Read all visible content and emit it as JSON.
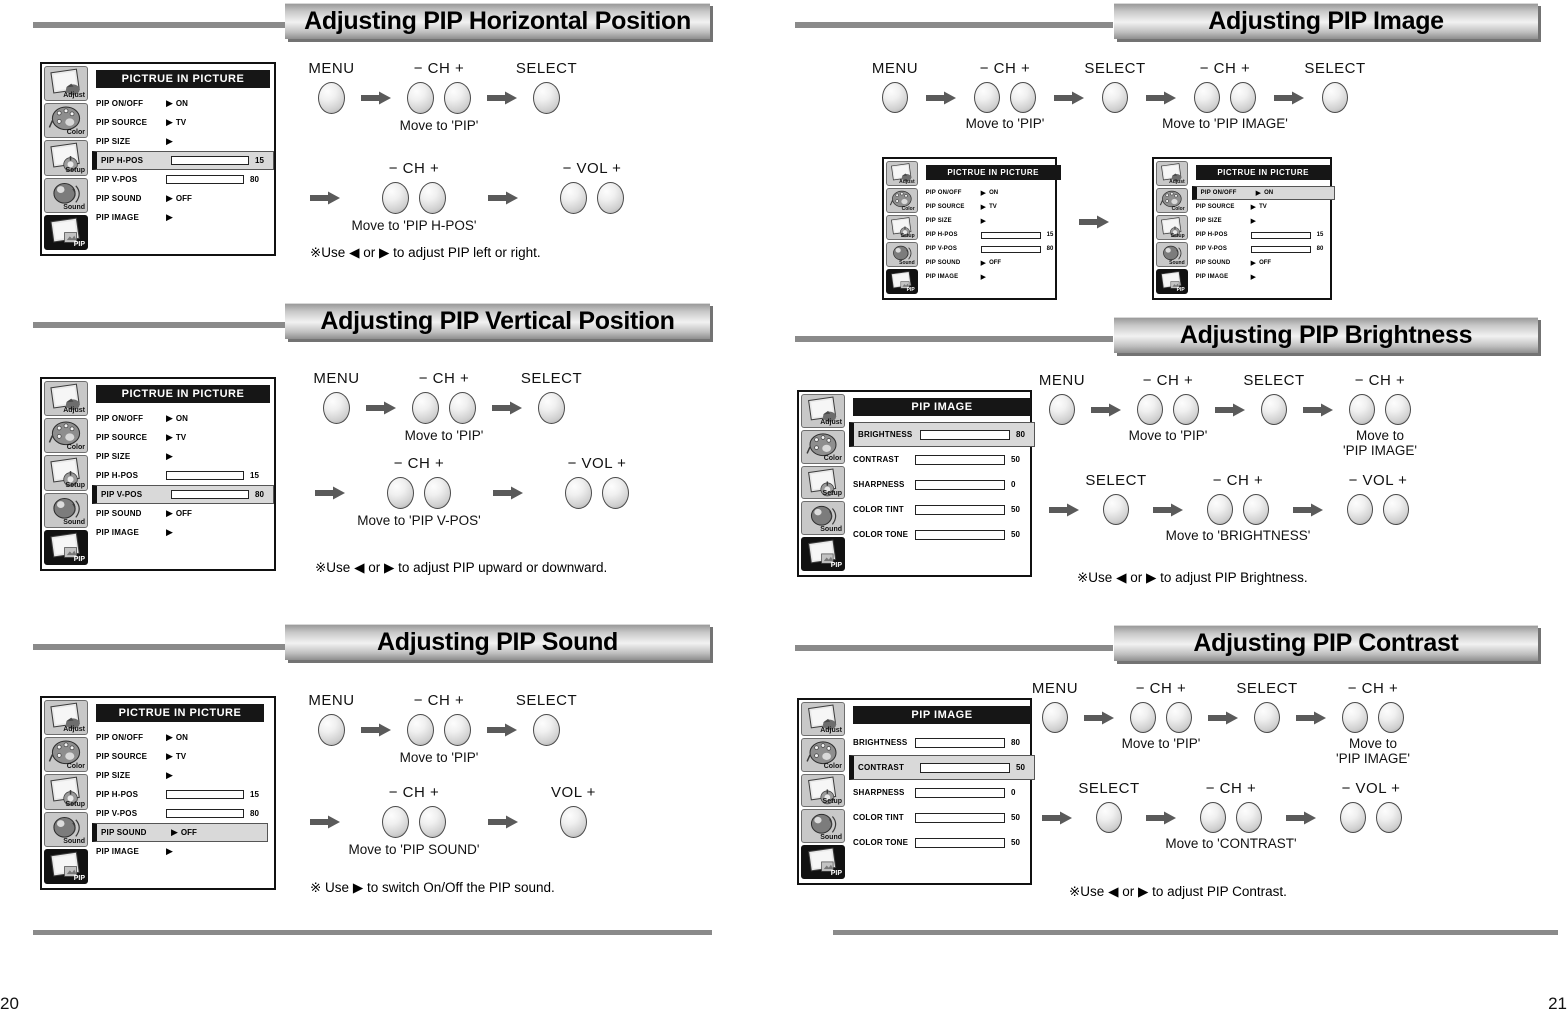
{
  "pages": [
    {
      "number": "20",
      "side": "left"
    },
    {
      "number": "21",
      "side": "right"
    }
  ],
  "icons": {
    "adjust": "Adjust",
    "color": "Color",
    "setup": "Setup",
    "sound": "Sound",
    "pip": "PIP"
  },
  "sections": {
    "h_pos": {
      "title": "Adjusting PIP Horizontal Position",
      "osd": {
        "title": "PICTRUE IN PICTURE",
        "rows": [
          {
            "label": "PIP ON/OFF",
            "type": "value",
            "value": "ON"
          },
          {
            "label": "PIP SOURCE",
            "type": "value",
            "value": "TV"
          },
          {
            "label": "PIP SIZE",
            "type": "value",
            "value": ""
          },
          {
            "label": "PIP H-POS",
            "type": "bar",
            "value": "15",
            "fill": 15,
            "highlight": true
          },
          {
            "label": "PIP V-POS",
            "type": "bar",
            "value": "80",
            "fill": 80
          },
          {
            "label": "PIP SOUND",
            "type": "value",
            "value": "OFF"
          },
          {
            "label": "PIP IMAGE",
            "type": "value",
            "value": ""
          }
        ]
      },
      "steps_row1": [
        {
          "key": "MENU",
          "buttons": 1,
          "caption": ""
        },
        {
          "key": "− CH +",
          "buttons": 2,
          "caption": "Move to 'PIP'"
        },
        {
          "key": "SELECT",
          "buttons": 1,
          "caption": ""
        }
      ],
      "steps_row2": [
        {
          "key": "− CH +",
          "buttons": 2,
          "caption": "Move to 'PIP H-POS'"
        },
        {
          "key": "− VOL +",
          "buttons": 2,
          "caption": ""
        }
      ],
      "note": "※Use ◀ or ▶ to adjust PIP left or right."
    },
    "v_pos": {
      "title": "Adjusting PIP Vertical Position",
      "osd": {
        "title": "PICTRUE IN PICTURE",
        "rows": [
          {
            "label": "PIP ON/OFF",
            "type": "value",
            "value": "ON"
          },
          {
            "label": "PIP SOURCE",
            "type": "value",
            "value": "TV"
          },
          {
            "label": "PIP SIZE",
            "type": "value",
            "value": ""
          },
          {
            "label": "PIP H-POS",
            "type": "bar",
            "value": "15",
            "fill": 15
          },
          {
            "label": "PIP V-POS",
            "type": "bar",
            "value": "80",
            "fill": 80,
            "highlight": true
          },
          {
            "label": "PIP SOUND",
            "type": "value",
            "value": "OFF"
          },
          {
            "label": "PIP IMAGE",
            "type": "value",
            "value": ""
          }
        ]
      },
      "steps_row1": [
        {
          "key": "MENU",
          "buttons": 1,
          "caption": ""
        },
        {
          "key": "− CH +",
          "buttons": 2,
          "caption": "Move to 'PIP'"
        },
        {
          "key": "SELECT",
          "buttons": 1,
          "caption": ""
        }
      ],
      "steps_row2": [
        {
          "key": "− CH +",
          "buttons": 2,
          "caption": "Move to 'PIP V-POS'"
        },
        {
          "key": "− VOL +",
          "buttons": 2,
          "caption": ""
        }
      ],
      "note": "※Use ◀ or ▶ to adjust PIP upward or downward."
    },
    "sound": {
      "title": "Adjusting PIP Sound",
      "osd": {
        "title": "PICTRUE IN PICTURE",
        "rows": [
          {
            "label": "PIP ON/OFF",
            "type": "value",
            "value": "ON"
          },
          {
            "label": "PIP SOURCE",
            "type": "value",
            "value": "TV"
          },
          {
            "label": "PIP SIZE",
            "type": "value",
            "value": ""
          },
          {
            "label": "PIP H-POS",
            "type": "bar",
            "value": "15",
            "fill": 15
          },
          {
            "label": "PIP V-POS",
            "type": "bar",
            "value": "80",
            "fill": 80
          },
          {
            "label": "PIP SOUND",
            "type": "value",
            "value": "OFF",
            "highlight": true
          },
          {
            "label": "PIP IMAGE",
            "type": "value",
            "value": ""
          }
        ]
      },
      "steps_row1": [
        {
          "key": "MENU",
          "buttons": 1,
          "caption": ""
        },
        {
          "key": "− CH +",
          "buttons": 2,
          "caption": "Move to 'PIP'"
        },
        {
          "key": "SELECT",
          "buttons": 1,
          "caption": ""
        }
      ],
      "steps_row2": [
        {
          "key": "− CH +",
          "buttons": 2,
          "caption": "Move to 'PIP SOUND'"
        },
        {
          "key": "VOL +",
          "buttons": 1,
          "caption": ""
        }
      ],
      "note": "※  Use ▶ to switch On/Off the PIP sound."
    },
    "image": {
      "title": "Adjusting PIP Image",
      "steps_row1": [
        {
          "key": "MENU",
          "buttons": 1,
          "caption": ""
        },
        {
          "key": "− CH +",
          "buttons": 2,
          "caption": "Move to 'PIP'"
        },
        {
          "key": "SELECT",
          "buttons": 1,
          "caption": ""
        },
        {
          "key": "− CH +",
          "buttons": 2,
          "caption": "Move to 'PIP IMAGE'"
        },
        {
          "key": "SELECT",
          "buttons": 1,
          "caption": ""
        }
      ],
      "osd_a": {
        "title": "PICTRUE IN PICTURE",
        "rows": [
          {
            "label": "PIP ON/OFF",
            "type": "value",
            "value": "ON"
          },
          {
            "label": "PIP SOURCE",
            "type": "value",
            "value": "TV"
          },
          {
            "label": "PIP SIZE",
            "type": "value",
            "value": ""
          },
          {
            "label": "PIP H-POS",
            "type": "bar",
            "value": "15",
            "fill": 15
          },
          {
            "label": "PIP V-POS",
            "type": "bar",
            "value": "80",
            "fill": 80
          },
          {
            "label": "PIP SOUND",
            "type": "value",
            "value": "OFF"
          },
          {
            "label": "PIP IMAGE",
            "type": "value",
            "value": ""
          }
        ]
      },
      "osd_b": {
        "title": "PICTRUE IN PICTURE",
        "rows": [
          {
            "label": "PIP ON/OFF",
            "type": "value",
            "value": "ON",
            "highlight": true
          },
          {
            "label": "PIP SOURCE",
            "type": "value",
            "value": "TV"
          },
          {
            "label": "PIP SIZE",
            "type": "value",
            "value": ""
          },
          {
            "label": "PIP H-POS",
            "type": "bar",
            "value": "15",
            "fill": 15
          },
          {
            "label": "PIP V-POS",
            "type": "bar",
            "value": "80",
            "fill": 80
          },
          {
            "label": "PIP SOUND",
            "type": "value",
            "value": "OFF"
          },
          {
            "label": "PIP IMAGE",
            "type": "value",
            "value": ""
          }
        ]
      }
    },
    "brightness": {
      "title": "Adjusting PIP Brightness",
      "osd": {
        "title": "PIP IMAGE",
        "rows": [
          {
            "label": "BRIGHTNESS",
            "type": "bar",
            "value": "80",
            "fill": 80,
            "highlight": true
          },
          {
            "label": "CONTRAST",
            "type": "bar",
            "value": "50",
            "fill": 50
          },
          {
            "label": "SHARPNESS",
            "type": "bar",
            "value": "0",
            "fill": 0
          },
          {
            "label": "COLOR TINT",
            "type": "bar",
            "value": "50",
            "fill": 50
          },
          {
            "label": "COLOR TONE",
            "type": "bar",
            "value": "50",
            "fill": 50
          }
        ]
      },
      "steps_row1": [
        {
          "key": "MENU",
          "buttons": 1,
          "caption": ""
        },
        {
          "key": "− CH +",
          "buttons": 2,
          "caption": "Move to 'PIP'"
        },
        {
          "key": "SELECT",
          "buttons": 1,
          "caption": ""
        },
        {
          "key": "− CH +",
          "buttons": 2,
          "caption": "Move to\n'PIP IMAGE'"
        }
      ],
      "steps_row2": [
        {
          "key": "SELECT",
          "buttons": 1,
          "caption": ""
        },
        {
          "key": "− CH +",
          "buttons": 2,
          "caption": "Move to 'BRIGHTNESS'"
        },
        {
          "key": "− VOL +",
          "buttons": 2,
          "caption": ""
        }
      ],
      "note": "※Use ◀ or ▶ to adjust PIP Brightness."
    },
    "contrast": {
      "title": "Adjusting PIP Contrast",
      "osd": {
        "title": "PIP IMAGE",
        "rows": [
          {
            "label": "BRIGHTNESS",
            "type": "bar",
            "value": "80",
            "fill": 80
          },
          {
            "label": "CONTRAST",
            "type": "bar",
            "value": "50",
            "fill": 50,
            "highlight": true
          },
          {
            "label": "SHARPNESS",
            "type": "bar",
            "value": "0",
            "fill": 0
          },
          {
            "label": "COLOR TINT",
            "type": "bar",
            "value": "50",
            "fill": 50
          },
          {
            "label": "COLOR TONE",
            "type": "bar",
            "value": "50",
            "fill": 50
          }
        ]
      },
      "steps_row1": [
        {
          "key": "MENU",
          "buttons": 1,
          "caption": ""
        },
        {
          "key": "− CH +",
          "buttons": 2,
          "caption": "Move to 'PIP'"
        },
        {
          "key": "SELECT",
          "buttons": 1,
          "caption": ""
        },
        {
          "key": "− CH +",
          "buttons": 2,
          "caption": "Move to\n'PIP IMAGE'"
        }
      ],
      "steps_row2": [
        {
          "key": "SELECT",
          "buttons": 1,
          "caption": ""
        },
        {
          "key": "− CH +",
          "buttons": 2,
          "caption": "Move to 'CONTRAST'"
        },
        {
          "key": "− VOL +",
          "buttons": 2,
          "caption": ""
        }
      ],
      "note": "※Use ◀ or ▶ to adjust PIP Contrast."
    }
  }
}
